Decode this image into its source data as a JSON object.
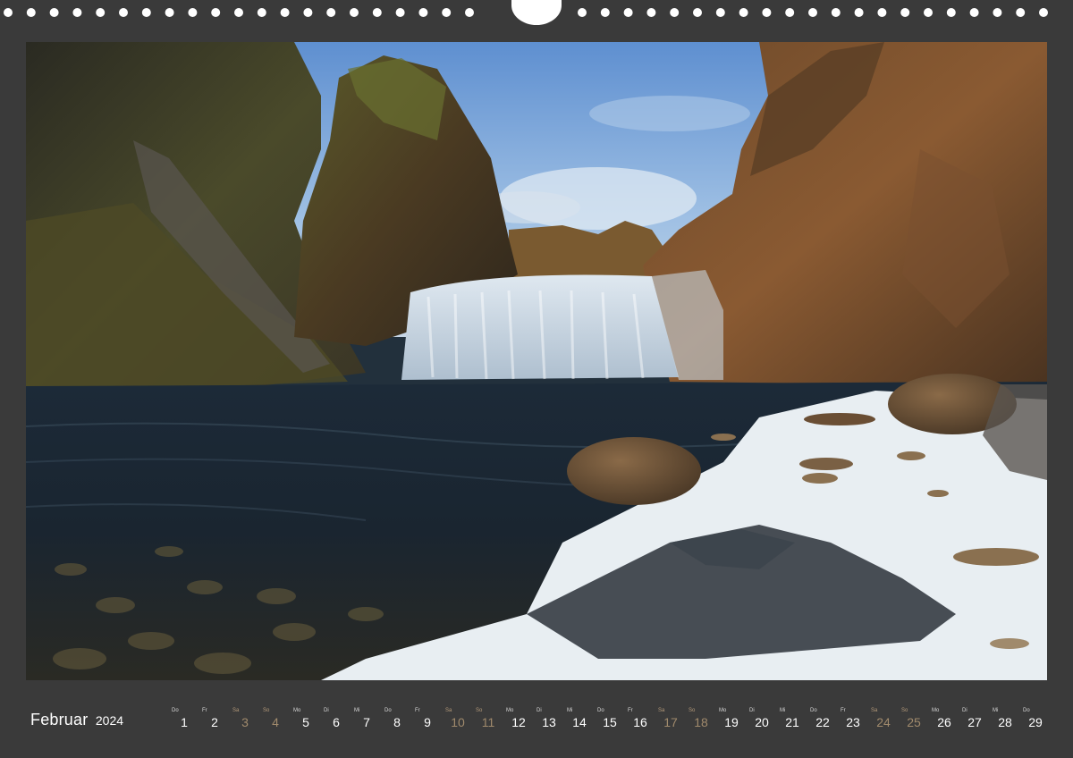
{
  "calendar": {
    "month": "Februar",
    "year": "2024",
    "days": [
      {
        "num": "1",
        "wd": "Do",
        "weekend": false
      },
      {
        "num": "2",
        "wd": "Fr",
        "weekend": false
      },
      {
        "num": "3",
        "wd": "Sa",
        "weekend": true
      },
      {
        "num": "4",
        "wd": "So",
        "weekend": true
      },
      {
        "num": "5",
        "wd": "Mo",
        "weekend": false
      },
      {
        "num": "6",
        "wd": "Di",
        "weekend": false
      },
      {
        "num": "7",
        "wd": "Mi",
        "weekend": false
      },
      {
        "num": "8",
        "wd": "Do",
        "weekend": false
      },
      {
        "num": "9",
        "wd": "Fr",
        "weekend": false
      },
      {
        "num": "10",
        "wd": "Sa",
        "weekend": true
      },
      {
        "num": "11",
        "wd": "So",
        "weekend": true
      },
      {
        "num": "12",
        "wd": "Mo",
        "weekend": false
      },
      {
        "num": "13",
        "wd": "Di",
        "weekend": false
      },
      {
        "num": "14",
        "wd": "Mi",
        "weekend": false
      },
      {
        "num": "15",
        "wd": "Do",
        "weekend": false
      },
      {
        "num": "16",
        "wd": "Fr",
        "weekend": false
      },
      {
        "num": "17",
        "wd": "Sa",
        "weekend": true
      },
      {
        "num": "18",
        "wd": "So",
        "weekend": true
      },
      {
        "num": "19",
        "wd": "Mo",
        "weekend": false
      },
      {
        "num": "20",
        "wd": "Di",
        "weekend": false
      },
      {
        "num": "21",
        "wd": "Mi",
        "weekend": false
      },
      {
        "num": "22",
        "wd": "Do",
        "weekend": false
      },
      {
        "num": "23",
        "wd": "Fr",
        "weekend": false
      },
      {
        "num": "24",
        "wd": "Sa",
        "weekend": true
      },
      {
        "num": "25",
        "wd": "So",
        "weekend": true
      },
      {
        "num": "26",
        "wd": "Mo",
        "weekend": false
      },
      {
        "num": "27",
        "wd": "Di",
        "weekend": false
      },
      {
        "num": "28",
        "wd": "Mi",
        "weekend": false
      },
      {
        "num": "29",
        "wd": "Do",
        "weekend": false
      }
    ]
  },
  "colors": {
    "background": "#3a3a3a",
    "weekday_text": "#ffffff",
    "weekend_text": "#a08a6c"
  },
  "photo": {
    "icon": "waterfall-landscape-photo"
  }
}
